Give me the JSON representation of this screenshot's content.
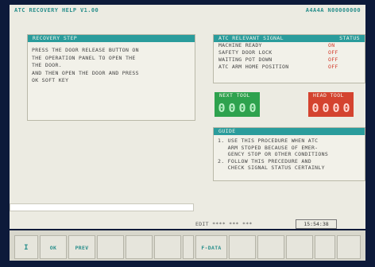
{
  "title_left": "ATC RECOVERY HELP V1.00",
  "title_right": "A4A4A N00000000",
  "recovery": {
    "header": "RECOVERY STEP",
    "text": "PRESS THE DOOR RELEASE BUTTON ON\nTHE OPERATION PANEL TO OPEN THE\nTHE DOOR.\nAND THEN OPEN THE DOOR AND PRESS\nOK SOFT KEY"
  },
  "signals": {
    "header_label": "ATC RELEVANT SIGNAL",
    "header_status": "STATUS",
    "rows": [
      {
        "name": "MACHINE READY",
        "status": "ON"
      },
      {
        "name": "SAFETY DOOR LOCK",
        "status": "OFF"
      },
      {
        "name": "WAITING POT DOWN",
        "status": "OFF"
      },
      {
        "name": "ATC ARM HOME POSITION",
        "status": "OFF"
      }
    ]
  },
  "next_tool": {
    "label": "NEXT  TOOL",
    "digits": [
      "0",
      "0",
      "0",
      "0"
    ]
  },
  "head_tool": {
    "label": "HEAD  TOOL",
    "digits": [
      "0",
      "0",
      "0",
      "0"
    ]
  },
  "guide": {
    "header": "GUIDE",
    "text": "1. USE THIS PROCEDURE WHEN ATC\n   ARM STOPED BECAUSE OF EMER-\n   GENCY STOP OR OTHER CONDITIONS\n2. FOLLOW THIS PRECEDURE AND\n   CHECK SIGNAL STATUS CERTAINLY"
  },
  "status": {
    "edit": "EDIT **** *** ***",
    "time": "15:54:38"
  },
  "softkeys": [
    "I",
    "OK",
    "PREV",
    "",
    "",
    "",
    "",
    "F-DATA",
    "",
    "",
    "",
    "",
    ""
  ],
  "colors": {
    "teal": "#2a9c9c",
    "green": "#2ea24e",
    "red": "#d4432f",
    "status_red": "#d23a2a"
  }
}
